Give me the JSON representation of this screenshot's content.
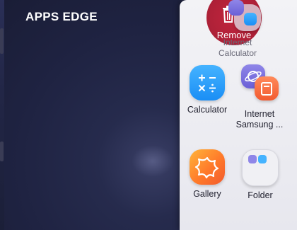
{
  "screen_title": "APPS EDGE",
  "remove_zone": {
    "label": "Remove"
  },
  "dragged_item": {
    "labels": [
      "Internet",
      "Calculator"
    ]
  },
  "apps": [
    {
      "label": "Calculator",
      "icon": "calculator-icon"
    },
    {
      "label": "Internet\nSamsung ...",
      "icon": "internet-samsung-pair-icon"
    },
    {
      "label": "Gallery",
      "icon": "gallery-icon"
    },
    {
      "label": "Folder",
      "icon": "folder-icon"
    }
  ],
  "colors": {
    "remove_red": "#b02138",
    "calculator_blue": "#1a8ef5",
    "gallery_orange": "#ff7a2a",
    "internet_purple": "#6a5fd6",
    "samsung_orange": "#f25a30"
  }
}
